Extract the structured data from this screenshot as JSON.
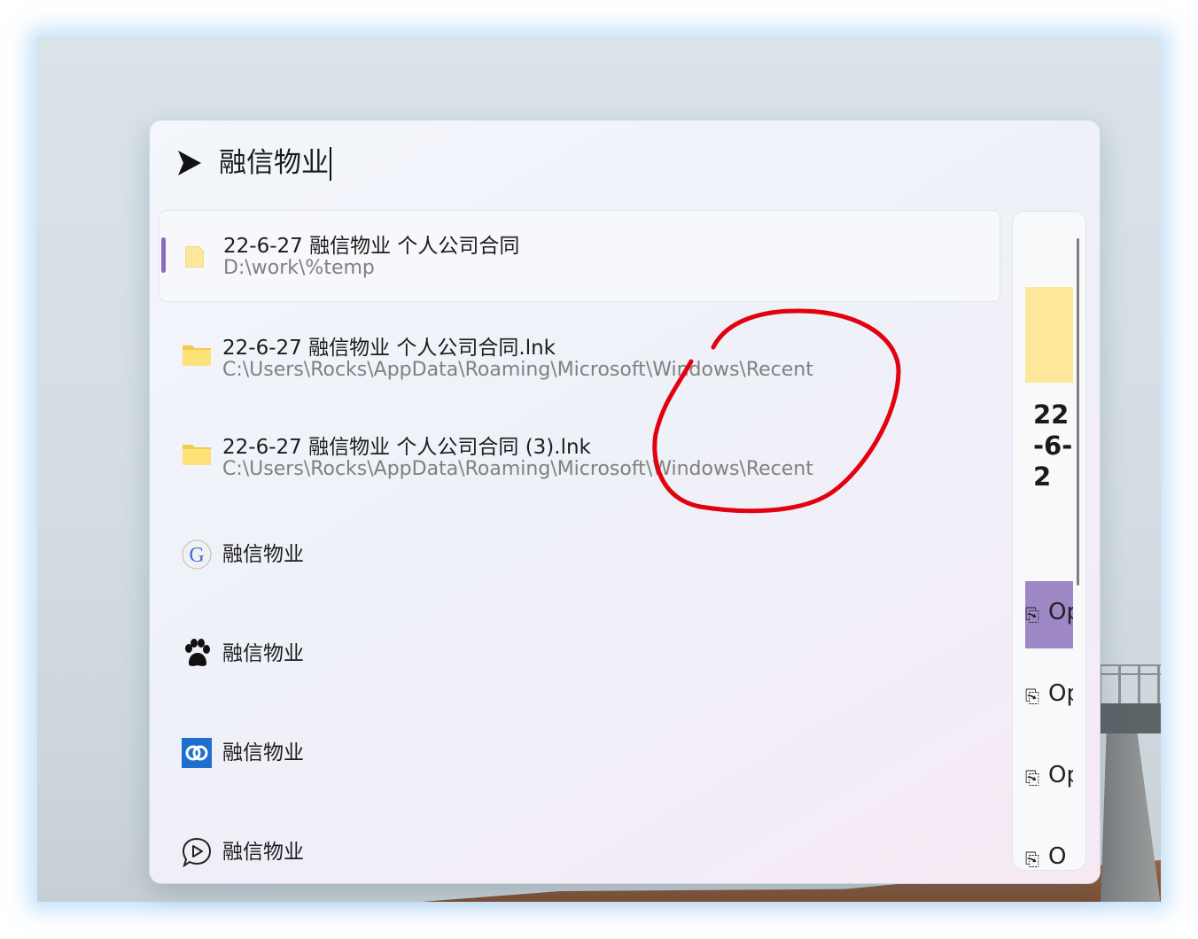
{
  "search": {
    "query": "融信物业"
  },
  "results": [
    {
      "title": "22-6-27 融信物业 个人公司合同",
      "subtitle": "D:\\work\\%temp",
      "icon": "folder-icon",
      "selected": true
    },
    {
      "title": "22-6-27 融信物业 个人公司合同.lnk",
      "subtitle": "C:\\Users\\Rocks\\AppData\\Roaming\\Microsoft\\Windows\\Recent",
      "icon": "folder-icon"
    },
    {
      "title": "22-6-27 融信物业 个人公司合同 (3).lnk",
      "subtitle": "C:\\Users\\Rocks\\AppData\\Roaming\\Microsoft\\Windows\\Recent",
      "icon": "folder-icon"
    },
    {
      "title": "融信物业",
      "icon": "google-icon"
    },
    {
      "title": "融信物业",
      "icon": "baidu-paw-icon"
    },
    {
      "title": "融信物业",
      "icon": "blue-search-icon"
    },
    {
      "title": "融信物业",
      "icon": "play-chat-icon"
    }
  ],
  "preview": {
    "title": "22-6-2",
    "buttons": [
      {
        "label": "Op",
        "active": true
      },
      {
        "label": "Op",
        "active": false
      },
      {
        "label": "Op",
        "active": false
      },
      {
        "label": "O",
        "active": false
      }
    ]
  },
  "colors": {
    "accent": "#8a6cbf",
    "annotation": "#e3000f",
    "folder": "#fcd96a"
  }
}
